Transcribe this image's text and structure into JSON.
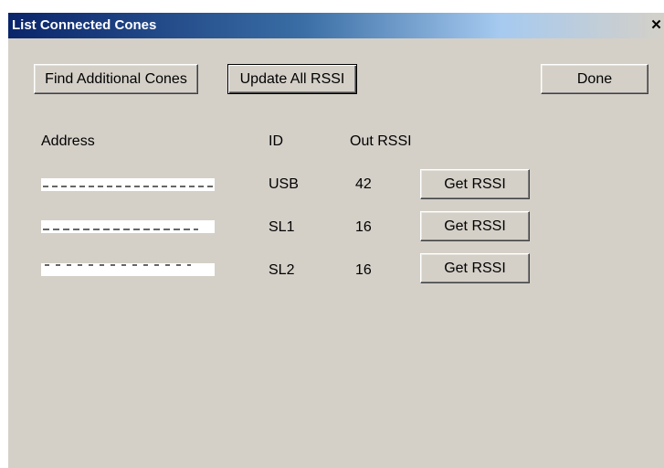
{
  "window": {
    "title": "List Connected Cones",
    "close_glyph": "✕"
  },
  "toolbar": {
    "find_label": "Find Additional Cones",
    "update_label": "Update All RSSI",
    "done_label": "Done"
  },
  "table": {
    "headers": {
      "address": "Address",
      "id": "ID",
      "out_rssi": "Out RSSI"
    },
    "rows": [
      {
        "address": "",
        "id": "USB",
        "out_rssi": "42",
        "button": "Get RSSI"
      },
      {
        "address": "",
        "id": "SL1",
        "out_rssi": "16",
        "button": "Get RSSI"
      },
      {
        "address": "",
        "id": "SL2",
        "out_rssi": "16",
        "button": "Get RSSI"
      }
    ]
  }
}
